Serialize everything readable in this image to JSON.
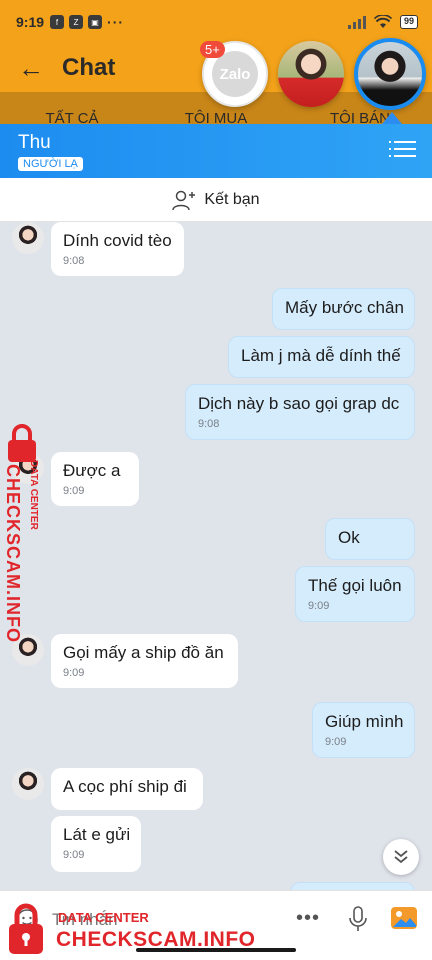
{
  "status_bar": {
    "time": "9:19",
    "battery": "99"
  },
  "background_app": {
    "title": "Chat",
    "tabs": [
      "TẤT CẢ",
      "TÔI MUA",
      "TÔI BÁN"
    ]
  },
  "chat_heads": {
    "zalo_label": "Zalo",
    "zalo_badge": "5+"
  },
  "chat": {
    "name": "Thu",
    "tag": "NGƯỜI LẠ",
    "add_friend": "Kết bạn",
    "messages": [
      {
        "dir": "in",
        "text": "Dính covid tèo",
        "time": "9:08"
      },
      {
        "dir": "out",
        "text": "Mấy bước chân",
        "time": ""
      },
      {
        "dir": "out",
        "text": "Làm j mà dễ dính thế",
        "time": ""
      },
      {
        "dir": "out",
        "text": "Dịch này b sao gọi grap dc",
        "time": "9:08"
      },
      {
        "dir": "in",
        "text": "Được a",
        "time": "9:09"
      },
      {
        "dir": "out",
        "text": "Ok",
        "time": ""
      },
      {
        "dir": "out",
        "text": "Thế gọi luôn",
        "time": "9:09"
      },
      {
        "dir": "in",
        "text": "Gọi mấy a ship đồ ăn",
        "time": "9:09"
      },
      {
        "dir": "out",
        "text": "Giúp mình",
        "time": "9:09"
      },
      {
        "dir": "in",
        "text": "A cọc phí ship đi",
        "time": ""
      },
      {
        "dir": "in",
        "text": "Lát e gửi",
        "time": "9:09"
      }
    ],
    "input_placeholder": "Tin nhắn"
  },
  "watermark": {
    "small": "DATA CENTER",
    "big": "CHECKSCAM.INFO"
  },
  "colors": {
    "accent": "#1d8cf0",
    "out_bubble": "#d5ecfc",
    "watermark": "#e1262b",
    "bg_app": "#f3a21a"
  }
}
